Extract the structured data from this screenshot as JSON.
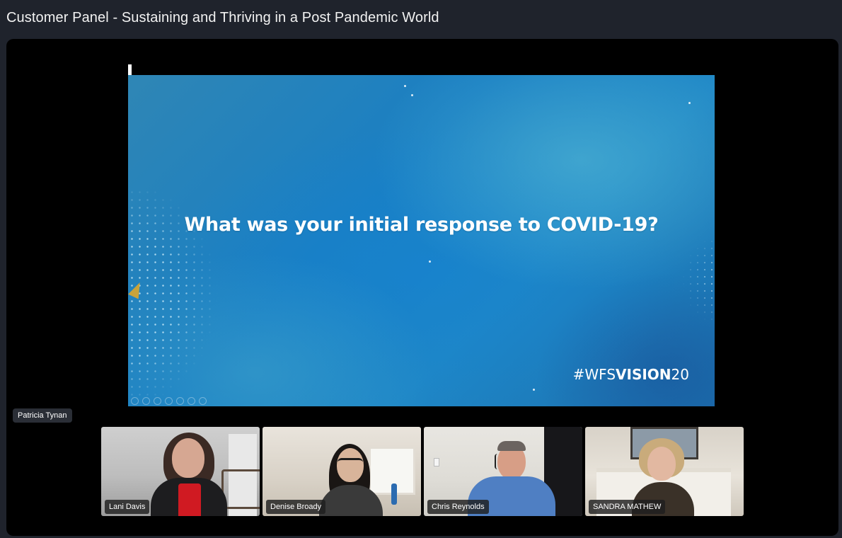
{
  "session": {
    "title": "Customer Panel - Sustaining and Thriving in a Post Pandemic World"
  },
  "slide": {
    "question": "What was your initial response to COVID-19?",
    "hashtag_prefix": "#WFS",
    "hashtag_bold": "VISION",
    "hashtag_suffix": "20"
  },
  "active_speaker": {
    "name": "Patricia Tynan"
  },
  "participants": [
    {
      "name": "Lani Davis"
    },
    {
      "name": "Denise Broady"
    },
    {
      "name": "Chris Reynolds"
    },
    {
      "name": "SANDRA MATHEW"
    }
  ]
}
